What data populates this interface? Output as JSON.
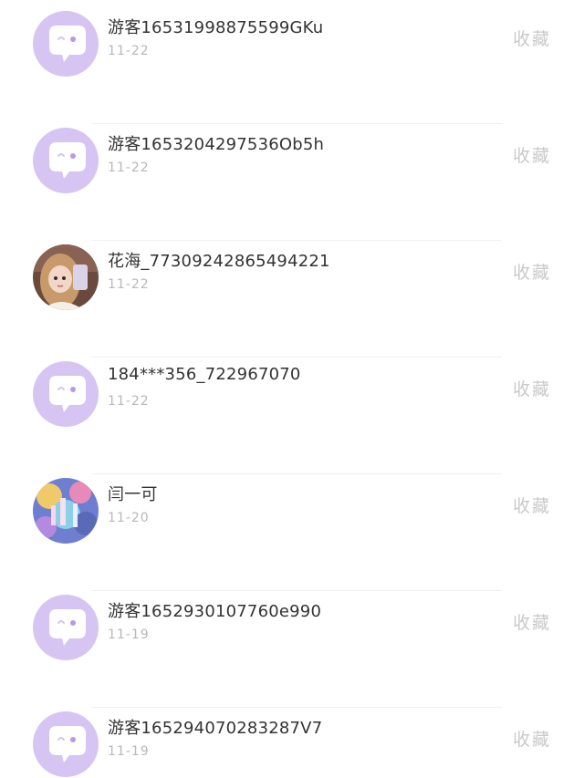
{
  "records": [
    {
      "name": "游客16531998875599GKu",
      "date": "11-22",
      "action": "收藏",
      "avatar": "default-chat-icon"
    },
    {
      "name": "游客1653204297536Ob5h",
      "date": "11-22",
      "action": "收藏",
      "avatar": "default-chat-icon"
    },
    {
      "name": "花海_77309242865494221",
      "date": "11-22",
      "action": "收藏",
      "avatar": "user-photo-girl"
    },
    {
      "name": "184***356_722967070",
      "date": "11-22",
      "action": "收藏",
      "avatar": "default-chat-icon"
    },
    {
      "name": "闫一可",
      "date": "11-20",
      "action": "收藏",
      "avatar": "user-photo-colorful"
    },
    {
      "name": "游客1652930107760e990",
      "date": "11-19",
      "action": "收藏",
      "avatar": "default-chat-icon"
    },
    {
      "name": "游客165294070283287V7",
      "date": "11-19",
      "action": "收藏",
      "avatar": "default-chat-icon"
    }
  ],
  "colors": {
    "default_avatar_bg": "#d6c4f2",
    "bubble": "#ffffff",
    "eye_dot": "#b79ae6",
    "name_text": "#333333",
    "date_text": "#b8b8b8",
    "action_text": "#c9c9c9"
  }
}
